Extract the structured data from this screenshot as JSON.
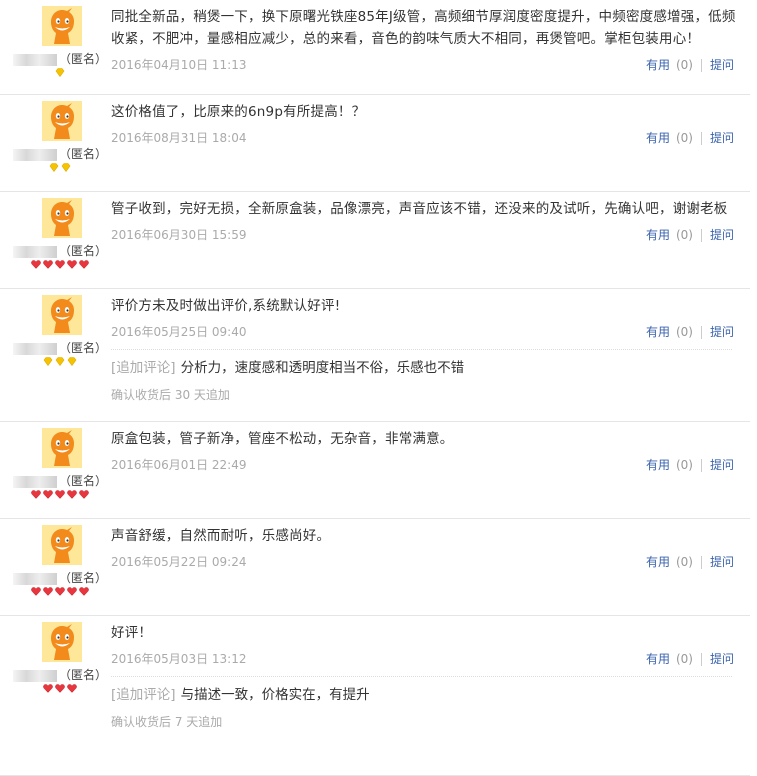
{
  "colors": {
    "link": "#3b63ac",
    "muted": "#aaaaaa",
    "border": "#e5e5e5",
    "avatar_bg": "#ffe79a",
    "mascot": "#f28a1c"
  },
  "anon_label": "（匿名）",
  "useful_label": "有用",
  "ask_label": "提问",
  "append_tag": "[追加评论]",
  "reviews": [
    {
      "text": "同批全新品，稍煲一下，换下原曙光铁座85年J级管，高频细节厚润度密度提升，中频密度感增强，低频收紧，不肥冲，量感相应减少，总的来看，音色的韵味气质大不相同，再煲管吧。掌柜包装用心！",
      "date": "2016年04月10日 11:13",
      "useful_count": "(0)",
      "level": {
        "type": "diamond-yellow",
        "count": 1
      }
    },
    {
      "text": "这价格值了，比原来的6n9p有所提高！？",
      "date": "2016年08月31日 18:04",
      "useful_count": "(0)",
      "level": {
        "type": "diamond-yellow",
        "count": 2
      }
    },
    {
      "text": "管子收到，完好无损，全新原盒装，品像漂亮，声音应该不错，还没来的及试听，先确认吧，谢谢老板",
      "date": "2016年06月30日 15:59",
      "useful_count": "(0)",
      "level": {
        "type": "heart-red",
        "count": 5
      }
    },
    {
      "text": "评价方未及时做出评价,系统默认好评!",
      "date": "2016年05月25日 09:40",
      "useful_count": "(0)",
      "level": {
        "type": "diamond-yellow",
        "count": 3
      },
      "append": {
        "text": "分析力，速度感和透明度相当不俗，乐感也不错",
        "note": "确认收货后 30 天追加"
      }
    },
    {
      "text": "原盒包装，管子新净，管座不松动，无杂音，非常满意。",
      "date": "2016年06月01日 22:49",
      "useful_count": "(0)",
      "level": {
        "type": "heart-red",
        "count": 5
      }
    },
    {
      "text": "声音舒缓，自然而耐听，乐感尚好。",
      "date": "2016年05月22日 09:24",
      "useful_count": "(0)",
      "level": {
        "type": "heart-red",
        "count": 5
      }
    },
    {
      "text": "好评！",
      "date": "2016年05月03日 13:12",
      "useful_count": "(0)",
      "level": {
        "type": "heart-red",
        "count": 3
      },
      "append": {
        "text": "与描述一致，价格实在，有提升",
        "note": "确认收货后 7 天追加"
      }
    }
  ]
}
